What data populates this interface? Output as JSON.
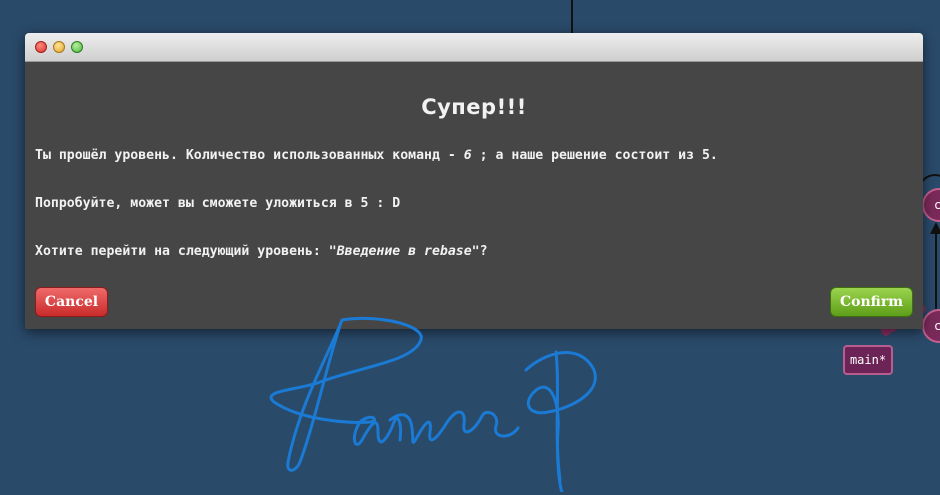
{
  "background": {
    "branch_label": "main*",
    "node_labels": [
      "c",
      "c"
    ]
  },
  "dialog": {
    "title": "Супер!!!",
    "line1": {
      "before": "Ты прошёл уровень. Количество использованных команд - ",
      "count": "6",
      "after": " ; а наше решение состоит из 5."
    },
    "line2": "Попробуйте, может вы сможете уложиться в 5 : D",
    "line3": {
      "before": "Хотите перейти на следующий уровень: ",
      "level_name": "\"Введение в rebase\"",
      "after": "?"
    },
    "cancel_label": "Cancel",
    "confirm_label": "Confirm"
  },
  "colors": {
    "background": "#2a4a6a",
    "dialog": "#464646",
    "cancel": "#d63b3b",
    "confirm": "#6cae22",
    "signature": "#1a7ad4"
  }
}
